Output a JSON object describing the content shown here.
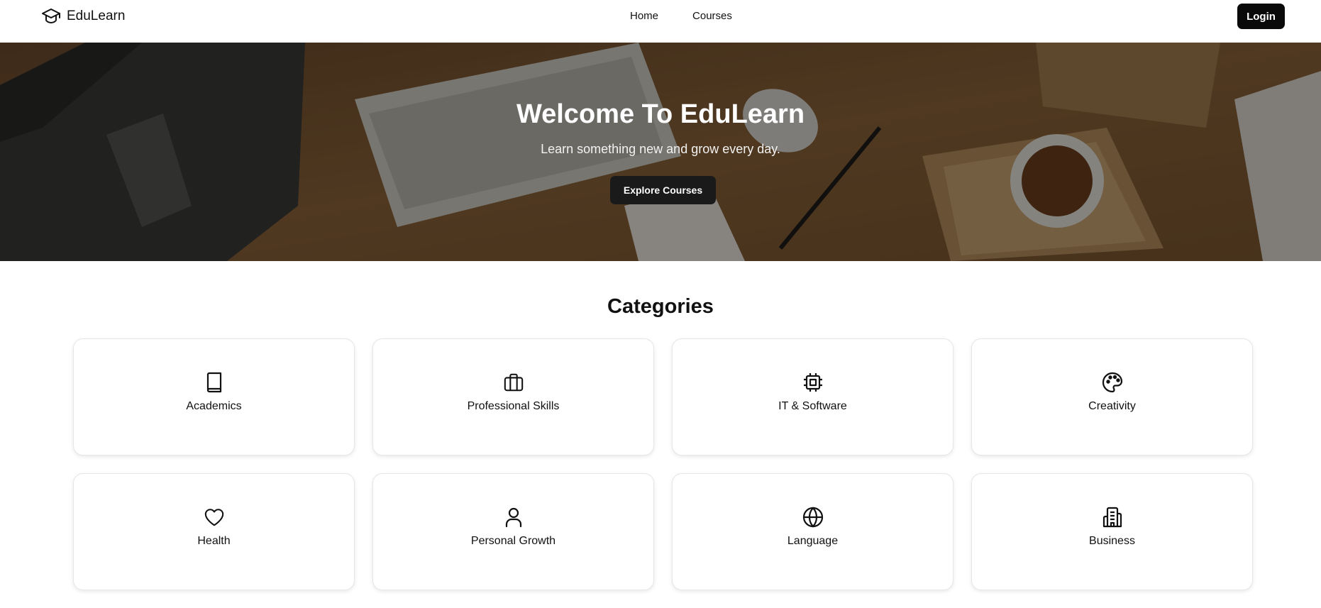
{
  "brand": {
    "name": "EduLearn",
    "icon": "graduation-cap-icon"
  },
  "nav": {
    "links": [
      "Home",
      "Courses"
    ],
    "login_label": "Login"
  },
  "hero": {
    "title": "Welcome To EduLearn",
    "subtitle": "Learn something new and grow every day.",
    "cta_label": "Explore Courses"
  },
  "categories": {
    "title": "Categories",
    "items": [
      {
        "label": "Academics",
        "icon": "book-icon"
      },
      {
        "label": "Professional Skills",
        "icon": "briefcase-icon"
      },
      {
        "label": "IT & Software",
        "icon": "cpu-chip-icon"
      },
      {
        "label": "Creativity",
        "icon": "palette-icon"
      },
      {
        "label": "Health",
        "icon": "heart-icon"
      },
      {
        "label": "Personal Growth",
        "icon": "user-icon"
      },
      {
        "label": "Language",
        "icon": "globe-icon"
      },
      {
        "label": "Business",
        "icon": "building-icon"
      }
    ]
  }
}
